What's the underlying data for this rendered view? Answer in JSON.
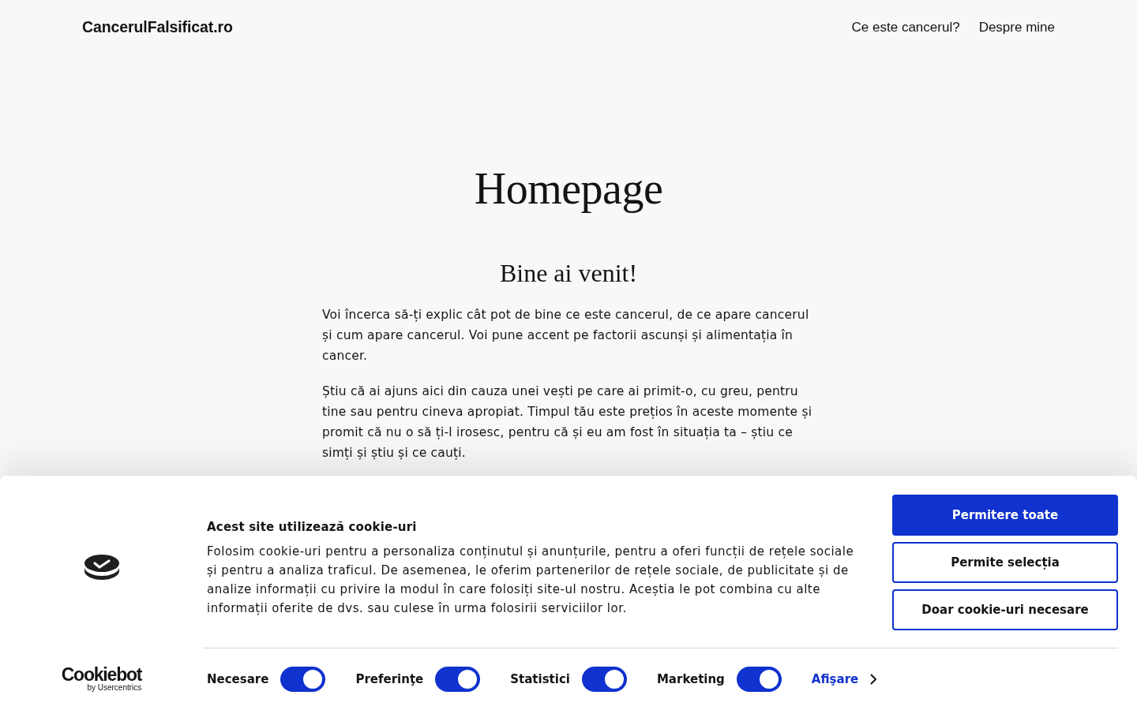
{
  "header": {
    "logo": "CancerulFalsificat.ro",
    "nav": [
      "Ce este cancerul?",
      "Despre mine"
    ]
  },
  "page": {
    "title": "Homepage",
    "heading": "Bine ai venit!",
    "paragraphs": [
      "Voi încerca să-ți explic cât pot de bine ce este cancerul, de ce apare cancerul și cum apare cancerul. Voi pune accent pe factorii ascunși și alimentația în cancer.",
      "Știu că ai ajuns aici din cauza unei vești pe care ai primit-o, cu greu, pentru tine sau pentru cineva apropiat. Timpul tău este prețios în aceste momente și promit că nu o să ți-l irosesc, pentru că și eu am fost în situația ta – știu ce simți și știu și ce cauți."
    ]
  },
  "cookie_banner": {
    "brand": {
      "name": "Cookiebot",
      "byline": "by Usercentrics"
    },
    "title": "Acest site utilizează cookie-uri",
    "text": "Folosim cookie-uri pentru a personaliza conținutul și anunțurile, pentru a oferi funcții de rețele sociale și pentru a analiza traficul. De asemenea, le oferim partenerilor de rețele sociale, de publicitate și de analize informații cu privire la modul în care folosiți site-ul nostru. Aceștia le pot combina cu alte informații oferite de dvs. sau culese în urma folosirii serviciilor lor.",
    "buttons": [
      {
        "label": "Permitere toate",
        "kind": "primary"
      },
      {
        "label": "Permite selecția",
        "kind": "outline"
      },
      {
        "label": "Doar cookie-uri necesare",
        "kind": "outline"
      }
    ],
    "toggles": [
      {
        "label": "Necesare",
        "on": true
      },
      {
        "label": "Preferinţe",
        "on": true
      },
      {
        "label": "Statistici",
        "on": true
      },
      {
        "label": "Marketing",
        "on": true
      }
    ],
    "details_link": "Afişare"
  }
}
